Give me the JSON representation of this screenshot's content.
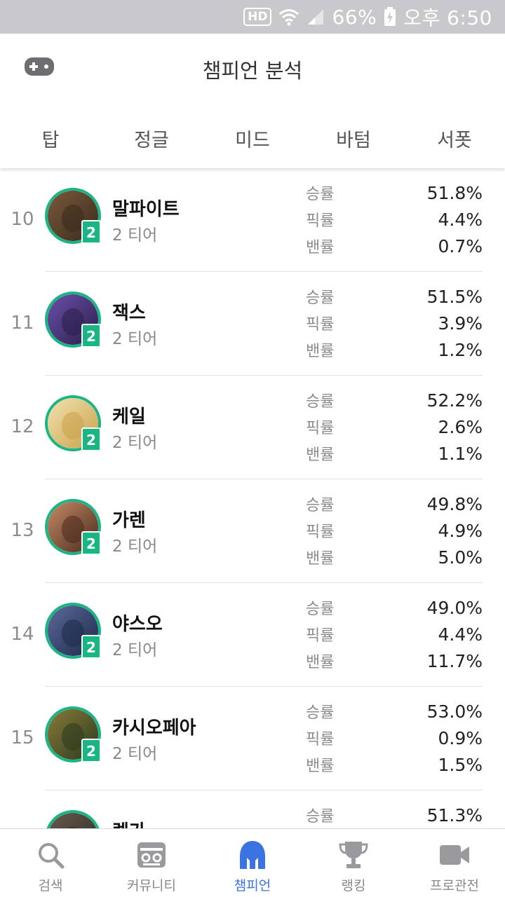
{
  "status_bar": {
    "hd": "HD",
    "battery": "66%",
    "time": "오후 6:50"
  },
  "header": {
    "title": "챔피언 분석",
    "left_icon": "gamepad-icon"
  },
  "tabs": [
    {
      "label": "탑",
      "active": true
    },
    {
      "label": "정글",
      "active": false
    },
    {
      "label": "미드",
      "active": false
    },
    {
      "label": "바텀",
      "active": false
    },
    {
      "label": "서폿",
      "active": false
    }
  ],
  "stat_labels": {
    "win": "승률",
    "pick": "픽률",
    "ban": "밴률"
  },
  "champions": [
    {
      "rank": "10",
      "name": "말파이트",
      "tier": "2 티어",
      "badge": "2",
      "win": "51.8%",
      "pick": "4.4%",
      "ban": "0.7%",
      "colors": [
        "#3a2a1e",
        "#7a5a3a"
      ]
    },
    {
      "rank": "11",
      "name": "잭스",
      "tier": "2 티어",
      "badge": "2",
      "win": "51.5%",
      "pick": "3.9%",
      "ban": "1.2%",
      "colors": [
        "#2a1f4a",
        "#6b4fa8"
      ]
    },
    {
      "rank": "12",
      "name": "케일",
      "tier": "2 티어",
      "badge": "2",
      "win": "52.2%",
      "pick": "2.6%",
      "ban": "1.1%",
      "colors": [
        "#c9a24a",
        "#f1e2b0"
      ]
    },
    {
      "rank": "13",
      "name": "가렌",
      "tier": "2 티어",
      "badge": "2",
      "win": "49.8%",
      "pick": "4.9%",
      "ban": "5.0%",
      "colors": [
        "#4a2a1e",
        "#c48a64"
      ]
    },
    {
      "rank": "14",
      "name": "야스오",
      "tier": "2 티어",
      "badge": "2",
      "win": "49.0%",
      "pick": "4.4%",
      "ban": "11.7%",
      "colors": [
        "#1e2a4a",
        "#5a6a9a"
      ]
    },
    {
      "rank": "15",
      "name": "카시오페아",
      "tier": "2 티어",
      "badge": "2",
      "win": "53.0%",
      "pick": "0.9%",
      "ban": "1.5%",
      "colors": [
        "#2a3a1e",
        "#8a7a3a"
      ]
    },
    {
      "rank": "",
      "name": "렝가",
      "tier": "",
      "badge": "",
      "win": "51.3%",
      "pick": "",
      "ban": "",
      "colors": [
        "#2a2a2a",
        "#6a5a4a"
      ]
    }
  ],
  "bottom_nav": [
    {
      "label": "검색",
      "icon": "search-icon",
      "active": false
    },
    {
      "label": "커뮤니티",
      "icon": "community-icon",
      "active": false
    },
    {
      "label": "챔피언",
      "icon": "champion-helmet-icon",
      "active": true
    },
    {
      "label": "랭킹",
      "icon": "trophy-icon",
      "active": false
    },
    {
      "label": "프로관전",
      "icon": "video-camera-icon",
      "active": false
    }
  ],
  "colors": {
    "accent": "#3b73e0",
    "tier_green": "#19b584",
    "status_bar": "#c9c9cd"
  }
}
